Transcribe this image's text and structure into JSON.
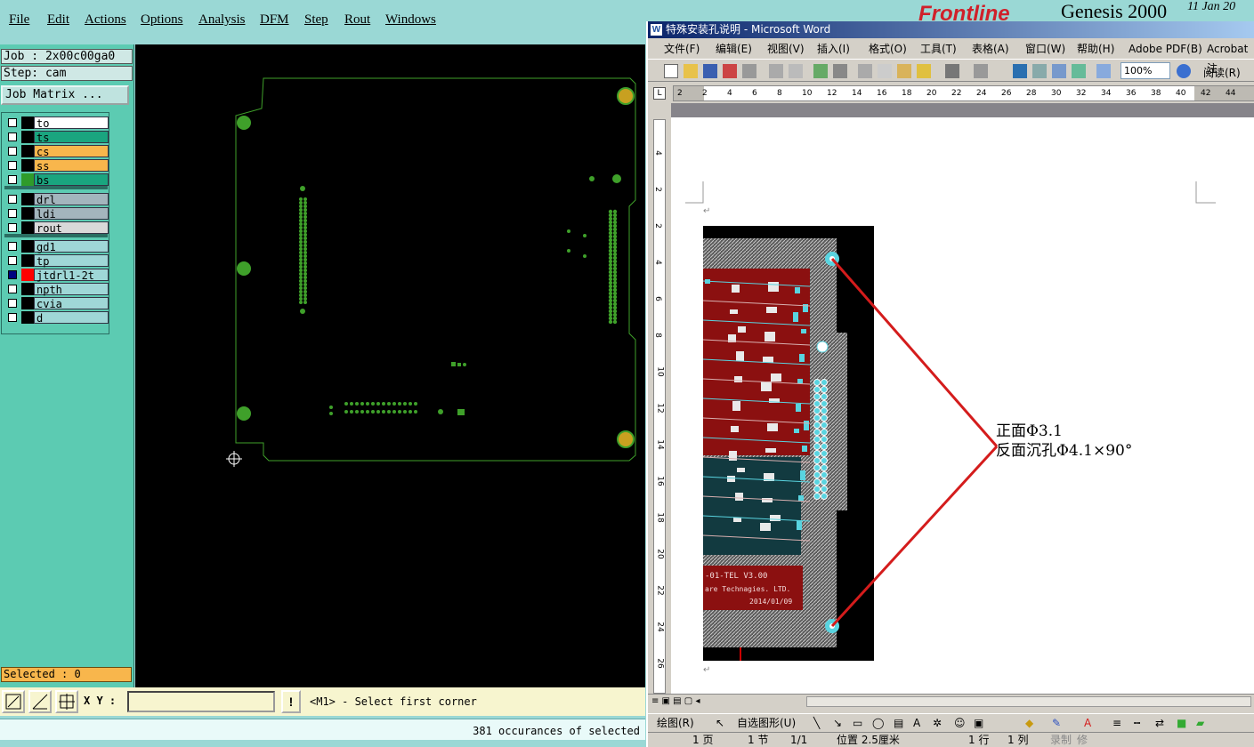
{
  "genesis": {
    "menu": [
      "File",
      "Edit",
      "Actions",
      "Options",
      "Analysis",
      "DFM",
      "Step",
      "Rout",
      "Windows"
    ],
    "job": "Job : 2x00c00ga0",
    "step": "Step: cam",
    "job_matrix": "Job Matrix ...",
    "layers_a": [
      {
        "name": "to",
        "color": "#ffffff",
        "swatch": "#000000",
        "on": false
      },
      {
        "name": "ts",
        "color": "#1aa57f",
        "swatch": "#000000",
        "on": false
      },
      {
        "name": "cs",
        "color": "#f8b64c",
        "swatch": "#000000",
        "on": false
      },
      {
        "name": "ss",
        "color": "#f8b64c",
        "swatch": "#000000",
        "on": false
      },
      {
        "name": "bs",
        "color": "#1aa57f",
        "swatch": "#2f9b2a",
        "on": false
      }
    ],
    "layers_b": [
      {
        "name": "drl",
        "color": "#a3b5bd",
        "swatch": "#000000",
        "on": false
      },
      {
        "name": "ldi",
        "color": "#a3b5bd",
        "swatch": "#000000",
        "on": false
      },
      {
        "name": "rout",
        "color": "#d9d9d9",
        "swatch": "#000000",
        "on": false
      }
    ],
    "layers_c": [
      {
        "name": "gd1",
        "color": "#9fd7d7",
        "swatch": "#000000",
        "on": false
      },
      {
        "name": "tp",
        "color": "#9fd7d7",
        "swatch": "#000000",
        "on": false
      },
      {
        "name": "jtdrl1-2t",
        "color": "#9fd7d7",
        "swatch": "#ff0000",
        "on": true
      },
      {
        "name": "npth",
        "color": "#9fd7d7",
        "swatch": "#000000",
        "on": false
      },
      {
        "name": "cvia",
        "color": "#9fd7d7",
        "swatch": "#000000",
        "on": false
      },
      {
        "name": "d",
        "color": "#9fd7d7",
        "swatch": "#000000",
        "on": false
      }
    ],
    "selected": "Selected : 0",
    "xy_label": "X Y :",
    "xy_value": "",
    "prompt": "<M1> - Select first corner",
    "status": "381 occurances of selected",
    "brand": "Genesis 2000",
    "brand_logo": "Frontline",
    "date": "11 Jan 20"
  },
  "word": {
    "title": "特殊安装孔说明 - Microsoft Word",
    "menu": [
      "文件(F)",
      "编辑(E)",
      "视图(V)",
      "插入(I)",
      "格式(O)",
      "工具(T)",
      "表格(A)",
      "窗口(W)",
      "帮助(H)",
      "Adobe PDF(B)",
      "Acrobat 注"
    ],
    "zoom": "100%",
    "read_button": "阅读(R)",
    "ruler_ticks": [
      "2",
      "2",
      "4",
      "6",
      "8",
      "10",
      "12",
      "14",
      "16",
      "18",
      "20",
      "22",
      "24",
      "26",
      "28",
      "30",
      "32",
      "34",
      "36",
      "38",
      "40",
      "42",
      "44"
    ],
    "vruler_ticks": [
      "4",
      "2",
      "2",
      "4",
      "6",
      "8",
      "10",
      "12",
      "14",
      "16",
      "18",
      "20",
      "22",
      "24",
      "26"
    ],
    "note_line1": "正面Φ3.1",
    "note_line2": "反面沉孔Φ4.1×90°",
    "pcb_label1": "-01-TEL    V3.00",
    "pcb_label2": "are Technagies. LTD.",
    "pcb_label3": "2014/01/09",
    "draw_label": "绘图(R)",
    "autoshape_label": "自选图形(U)",
    "status": {
      "page": "1 页",
      "section": "1 节",
      "pages": "1/1",
      "position": "位置 2.5厘米",
      "line": "1 行",
      "col": "1 列",
      "rec": "录制",
      "rev": "修"
    }
  }
}
